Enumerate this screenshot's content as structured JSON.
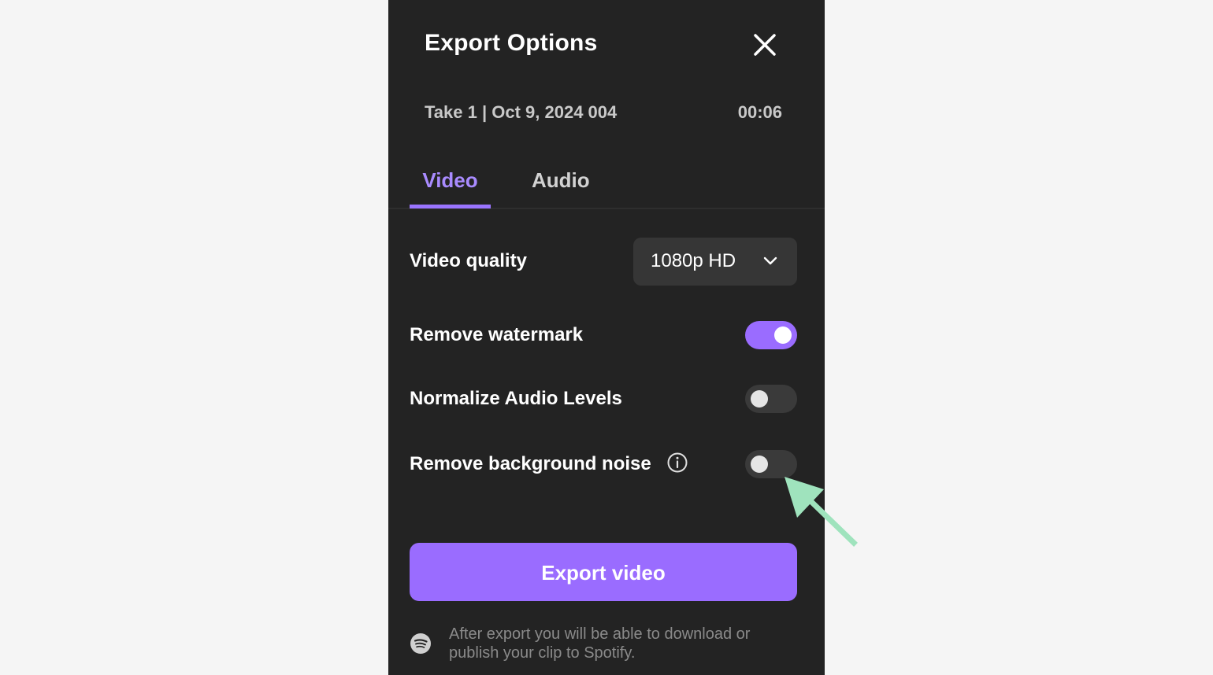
{
  "dialog": {
    "title": "Export Options",
    "take_name": "Take 1 | Oct 9, 2024 004",
    "take_duration": "00:06"
  },
  "tabs": [
    {
      "label": "Video",
      "active": true
    },
    {
      "label": "Audio",
      "active": false
    }
  ],
  "settings": {
    "video_quality": {
      "label": "Video quality",
      "selected": "1080p HD"
    },
    "remove_watermark": {
      "label": "Remove watermark",
      "enabled": true
    },
    "normalize_audio": {
      "label": "Normalize Audio Levels",
      "enabled": false
    },
    "remove_noise": {
      "label": "Remove background noise",
      "enabled": false
    }
  },
  "actions": {
    "export_label": "Export video"
  },
  "footer": {
    "note": "After export you will be able to download or publish your clip to Spotify."
  },
  "colors": {
    "accent": "#9a6cff",
    "panel_bg": "#232323",
    "annotation_arrow": "#9fe3bd"
  },
  "icons": {
    "close": "close-icon",
    "chevron": "chevron-down-icon",
    "info": "info-icon",
    "footer": "spotify-icon"
  }
}
